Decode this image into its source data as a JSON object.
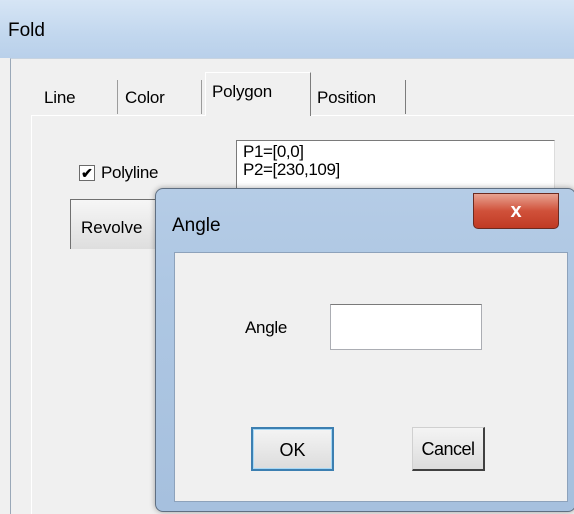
{
  "window": {
    "title": "Fold"
  },
  "tabs": [
    {
      "label": "Line"
    },
    {
      "label": "Color"
    },
    {
      "label": "Polygon"
    },
    {
      "label": "Position"
    }
  ],
  "polygon": {
    "polyline_label": "Polyline",
    "polyline_checked": true,
    "points": [
      "P1=[0,0]",
      "P2=[230,109]"
    ],
    "revolve_label": "Revolve"
  },
  "dialog": {
    "title": "Angle",
    "close_glyph": "x",
    "angle_label": "Angle",
    "angle_value": "",
    "ok_label": "OK",
    "cancel_label": "Cancel"
  }
}
